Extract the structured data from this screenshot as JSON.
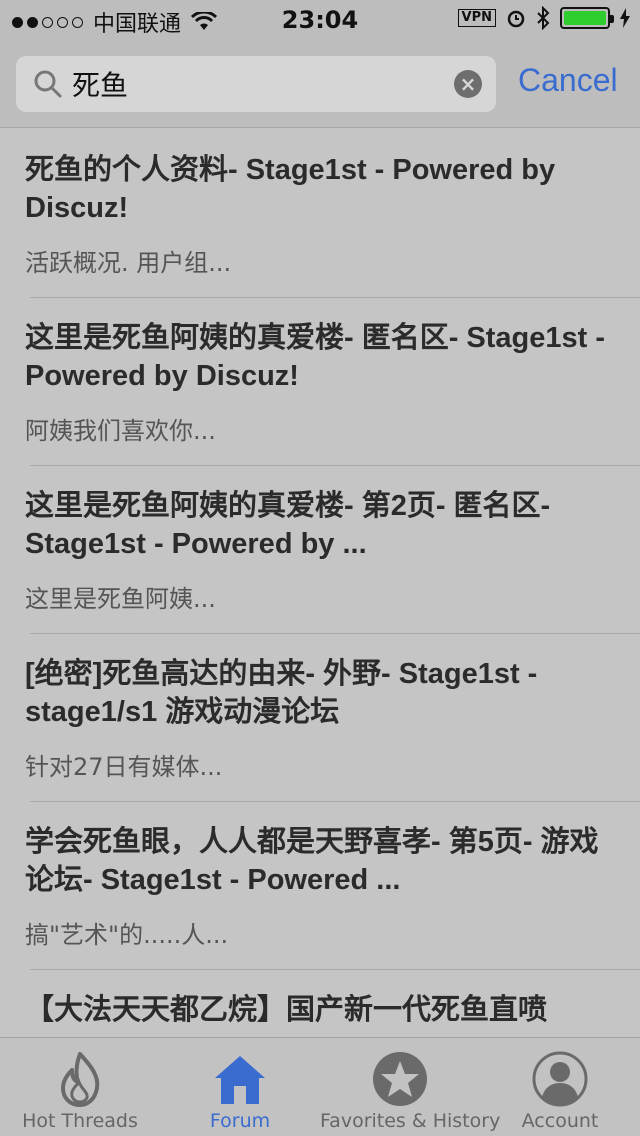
{
  "status_bar": {
    "carrier": "中国联通",
    "time": "23:04",
    "vpn": "VPN"
  },
  "search": {
    "query": "死鱼",
    "cancel_label": "Cancel"
  },
  "results": [
    {
      "title": "死鱼的个人资料- Stage1st - Powered by Discuz!",
      "snippet": "活跃概况. 用户组..."
    },
    {
      "title": "这里是死鱼阿姨的真爱楼- 匿名区- Stage1st - Powered by Discuz!",
      "snippet": "阿姨我们喜欢你..."
    },
    {
      "title": "这里是死鱼阿姨的真爱楼- 第2页- 匿名区- Stage1st - Powered by ...",
      "snippet": "这里是死鱼阿姨..."
    },
    {
      "title": "[绝密]死鱼高达的由来- 外野- Stage1st - stage1/s1 游戏动漫论坛",
      "snippet": "针对27日有媒体..."
    },
    {
      "title": "学会死鱼眼，人人都是天野喜孝- 第5页- 游戏论坛- Stage1st - Powered ...",
      "snippet": "搞\"艺术\"的.....人..."
    },
    {
      "title": "【大法天天都乙烷】国产新一代死鱼直喷",
      "snippet": ""
    }
  ],
  "tabs": [
    {
      "label": "Hot Threads",
      "icon": "flame-icon",
      "active": false
    },
    {
      "label": "Forum",
      "icon": "home-icon",
      "active": true
    },
    {
      "label": "Favorites & History",
      "icon": "star-icon",
      "active": false
    },
    {
      "label": "Account",
      "icon": "person-icon",
      "active": false
    }
  ],
  "colors": {
    "accent": "#3a6cd0",
    "battery": "#2fce2f"
  }
}
